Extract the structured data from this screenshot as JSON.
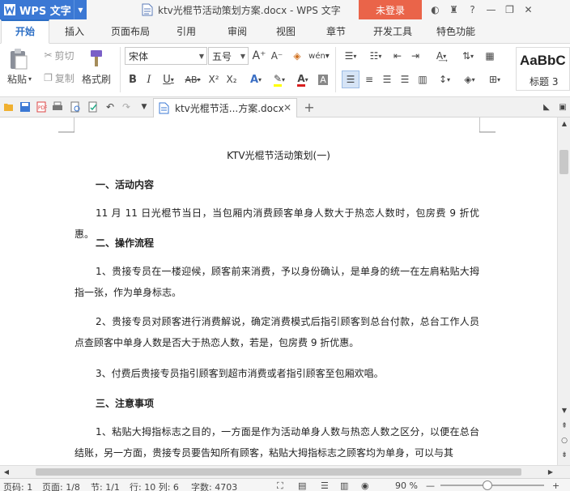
{
  "app": {
    "name": "WPS 文字",
    "window_title": "ktv光棍节活动策划方案.docx - WPS 文字",
    "login_label": "未登录"
  },
  "tabs": [
    "开始",
    "插入",
    "页面布局",
    "引用",
    "审阅",
    "视图",
    "章节",
    "开发工具",
    "特色功能"
  ],
  "ribbon": {
    "paste": "粘贴",
    "cut": "剪切",
    "copy": "复制",
    "format_painter": "格式刷",
    "font_name": "宋体",
    "font_size": "五号",
    "style_preview": "AaBbC",
    "style_name": "标题 3"
  },
  "doc_tab": {
    "title": "ktv光棍节活...方案.docx"
  },
  "document": {
    "title": "KTV光棍节活动策划(一)",
    "h1": "一、活动内容",
    "p1": "11 月 11 日光棍节当日，当包厢内消费顾客单身人数大于热恋人数时，包房费 9 折优惠。",
    "h2": "二、操作流程",
    "p2": "1、贵接专员在一楼迎候，顾客前来消费，予以身份确认，是单身的统一在左肩粘贴大拇指一张，作为单身标志。",
    "p3": "2、贵接专员对顾客进行消费解说，确定消费模式后指引顾客到总台付款，总台工作人员点查顾客中单身人数是否大于热恋人数，若是，包房费 9 折优惠。",
    "p4": "3、付费后贵接专员指引顾客到超市消费或者指引顾客至包厢欢唱。",
    "h3": "三、注意事项",
    "p5": "1、粘贴大拇指标志之目的，一方面是作为活动单身人数与热恋人数之区分，以便在总台结账，另一方面，贵接专员要告知所有顾客，粘贴大拇指标志之顾客均为单身，可以与其"
  },
  "status": {
    "page_num": "页码: 1",
    "page": "页面: 1/8",
    "section": "节: 1/1",
    "row_col": "行: 10  列: 6",
    "words": "字数: 4703",
    "zoom": "90 %"
  },
  "colors": {
    "accent": "#2b6ec5",
    "app_blue": "#3b78d4",
    "login_red": "#ea6449"
  }
}
